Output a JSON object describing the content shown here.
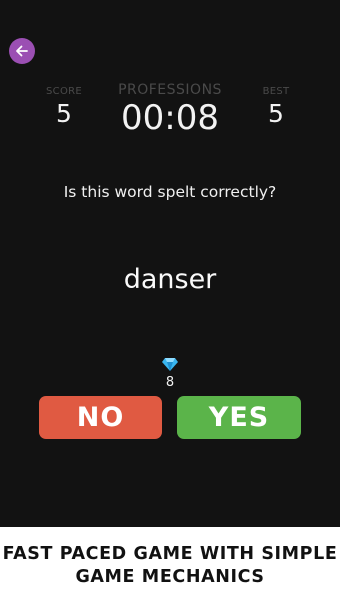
{
  "header": {
    "score_label": "SCORE",
    "score_value": "5",
    "category": "PROFESSIONS",
    "timer": "00:08",
    "best_label": "BEST",
    "best_value": "5"
  },
  "question": "Is this word spelt correctly?",
  "word": "danser",
  "gems": {
    "icon": "diamond-icon",
    "count": "8"
  },
  "buttons": {
    "no": "NO",
    "yes": "YES"
  },
  "banner": {
    "line1": "FAST PACED GAME WITH SIMPLE",
    "line2": "GAME MECHANICS"
  },
  "colors": {
    "back": "#9b4fb3",
    "no": "#e05a42",
    "yes": "#5bb44a",
    "gem": "#39b6f0"
  }
}
